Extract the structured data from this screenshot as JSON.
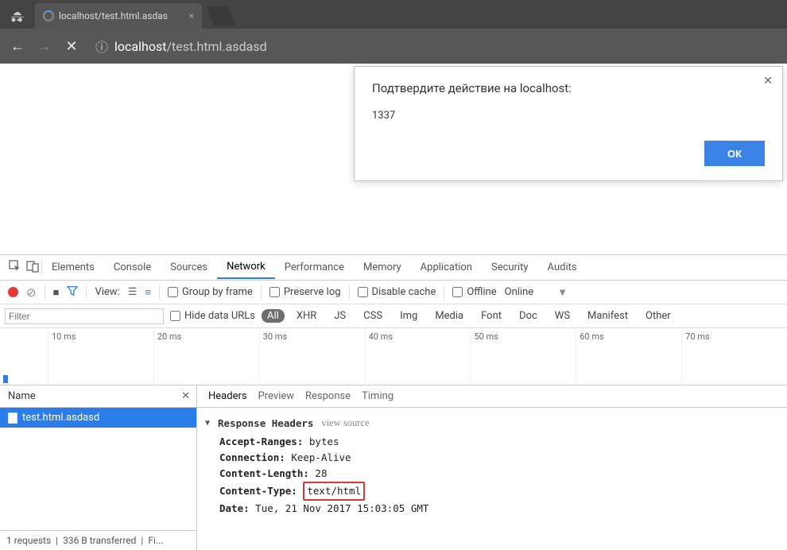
{
  "tab": {
    "title": "localhost/test.html.asdas",
    "close_glyph": "×"
  },
  "nav": {
    "url_host": "localhost",
    "url_path": "/test.html.asdasd",
    "info_glyph": "ⓘ"
  },
  "dialog": {
    "title": "Подтвердите действие на localhost:",
    "body": "1337",
    "ok": "ОК",
    "close_glyph": "✕"
  },
  "devtools": {
    "tabs": [
      "Elements",
      "Console",
      "Sources",
      "Network",
      "Performance",
      "Memory",
      "Application",
      "Security",
      "Audits"
    ],
    "toolbar": {
      "view": "View:",
      "group_by_frame": "Group by frame",
      "preserve_log": "Preserve log",
      "disable_cache": "Disable cache",
      "offline": "Offline",
      "online": "Online"
    },
    "filter": {
      "placeholder": "Filter",
      "hide_data_urls": "Hide data URLs",
      "types": [
        "All",
        "XHR",
        "JS",
        "CSS",
        "Img",
        "Media",
        "Font",
        "Doc",
        "WS",
        "Manifest",
        "Other"
      ]
    },
    "timeline_ticks": [
      "10 ms",
      "20 ms",
      "30 ms",
      "40 ms",
      "50 ms",
      "60 ms",
      "70 ms"
    ],
    "name_header": "Name",
    "file": "test.html.asdasd",
    "status": {
      "requests": "1 requests",
      "transferred": "336 B transferred",
      "finish": "Fi..."
    },
    "subtabs": [
      "Headers",
      "Preview",
      "Response",
      "Timing"
    ],
    "response": {
      "section": "Response Headers",
      "view_source": "view source",
      "headers": [
        {
          "k": "Accept-Ranges:",
          "v": "bytes"
        },
        {
          "k": "Connection:",
          "v": "Keep-Alive"
        },
        {
          "k": "Content-Length:",
          "v": "28"
        },
        {
          "k": "Content-Type:",
          "v": "text/html",
          "hl": true
        },
        {
          "k": "Date:",
          "v": "Tue, 21 Nov 2017 15:03:05 GMT"
        }
      ]
    }
  }
}
